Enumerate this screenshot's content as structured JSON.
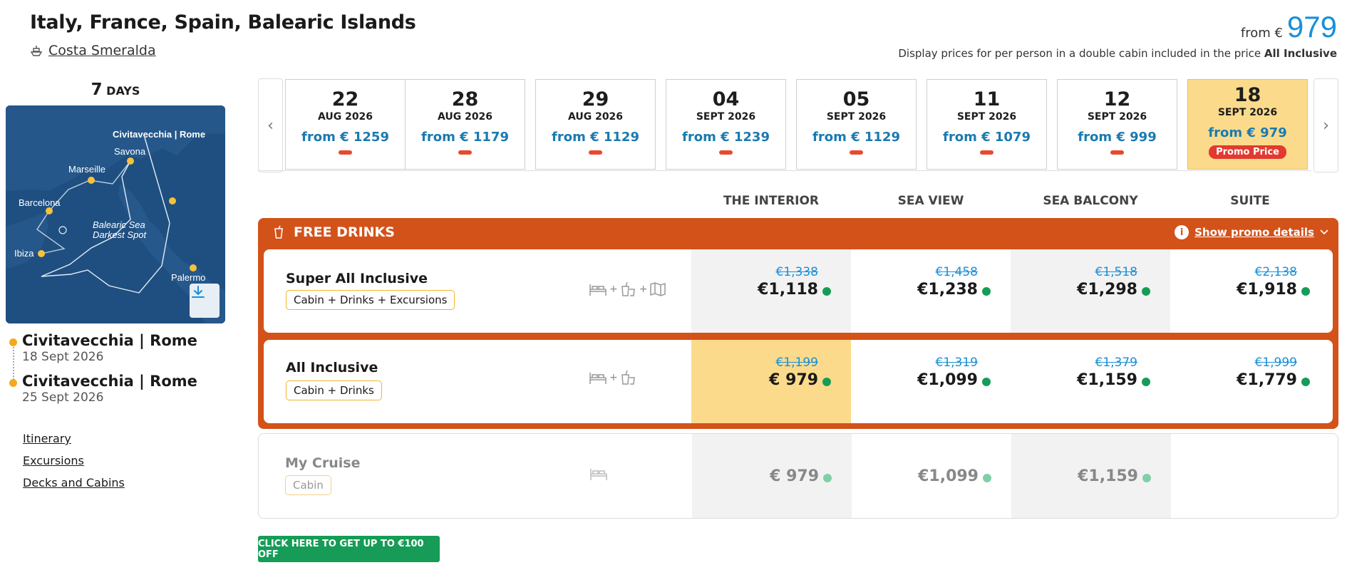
{
  "header": {
    "title": "Italy, France, Spain, Balearic Islands",
    "ship": "Costa Smeralda",
    "price_from": "from €",
    "price_value": "979",
    "disclaimer_text": "Display prices for per person in a double cabin included in the price",
    "disclaimer_bold": "All Inclusive"
  },
  "itinerary": {
    "days_num": "7",
    "days_unit": "DAYS",
    "map_labels": {
      "civitavecchia": "Civitavecchia | Rome",
      "savona": "Savona",
      "marseille": "Marseille",
      "barcelona": "Barcelona",
      "balearic": "Balearic Sea",
      "darkest": "Darkest Spot",
      "ibiza": "Ibiza",
      "palermo": "Palermo"
    },
    "departure_port": "Civitavecchia | Rome",
    "departure_date": "18 Sept 2026",
    "arrival_port": "Civitavecchia | Rome",
    "arrival_date": "25 Sept 2026",
    "links": [
      "Itinerary",
      "Excursions",
      "Decks and Cabins"
    ]
  },
  "dates": [
    {
      "day": "22",
      "month": "AUG 2026",
      "price": "from € 1259"
    },
    {
      "day": "28",
      "month": "AUG 2026",
      "price": "from € 1179"
    },
    {
      "day": "29",
      "month": "AUG 2026",
      "price": "from € 1129"
    },
    {
      "day": "04",
      "month": "SEPT 2026",
      "price": "from € 1239"
    },
    {
      "day": "05",
      "month": "SEPT 2026",
      "price": "from € 1129"
    },
    {
      "day": "11",
      "month": "SEPT 2026",
      "price": "from € 1079"
    },
    {
      "day": "12",
      "month": "SEPT 2026",
      "price": "from € 999"
    },
    {
      "day": "18",
      "month": "SEPT 2026",
      "price": "from € 979",
      "badge": "Promo Price"
    }
  ],
  "nav": {
    "prev": "‹",
    "next": "›"
  },
  "columns": [
    "THE INTERIOR",
    "SEA VIEW",
    "SEA BALCONY",
    "SUITE"
  ],
  "promo": {
    "title": "FREE DRINKS",
    "details": "Show promo details",
    "info_glyph": "i"
  },
  "packages": [
    {
      "name": "Super All Inclusive",
      "tag": "Cabin + Drinks + Excursions",
      "icons": [
        "bed-icon",
        "drinks-icon",
        "map-icon"
      ],
      "prices": [
        {
          "old": "€1,338",
          "new": "€1,118"
        },
        {
          "old": "€1,458",
          "new": "€1,238"
        },
        {
          "old": "€1,518",
          "new": "€1,298"
        },
        {
          "old": "€2,138",
          "new": "€1,918"
        }
      ]
    },
    {
      "name": "All Inclusive",
      "tag": "Cabin + Drinks",
      "icons": [
        "bed-icon",
        "drinks-icon"
      ],
      "prices": [
        {
          "old": "€1,199",
          "new": "€ 979"
        },
        {
          "old": "€1,319",
          "new": "€1,099"
        },
        {
          "old": "€1,379",
          "new": "€1,159"
        },
        {
          "old": "€1,999",
          "new": "€1,779"
        }
      ]
    },
    {
      "name": "My Cruise",
      "tag": "Cabin",
      "icons": [
        "bed-icon"
      ],
      "prices": [
        {
          "new": "€ 979"
        },
        {
          "new": "€1,099"
        },
        {
          "new": "€1,159"
        }
      ]
    }
  ],
  "plus": "+",
  "cta": "CLICK HERE TO GET UP TO €100 OFF",
  "colors": {
    "accent_blue": "#1a8fd8",
    "promo_orange": "#d3521a",
    "highlight": "#fbdb8b",
    "available_green": "#169c57",
    "cta_green": "#169c57"
  }
}
